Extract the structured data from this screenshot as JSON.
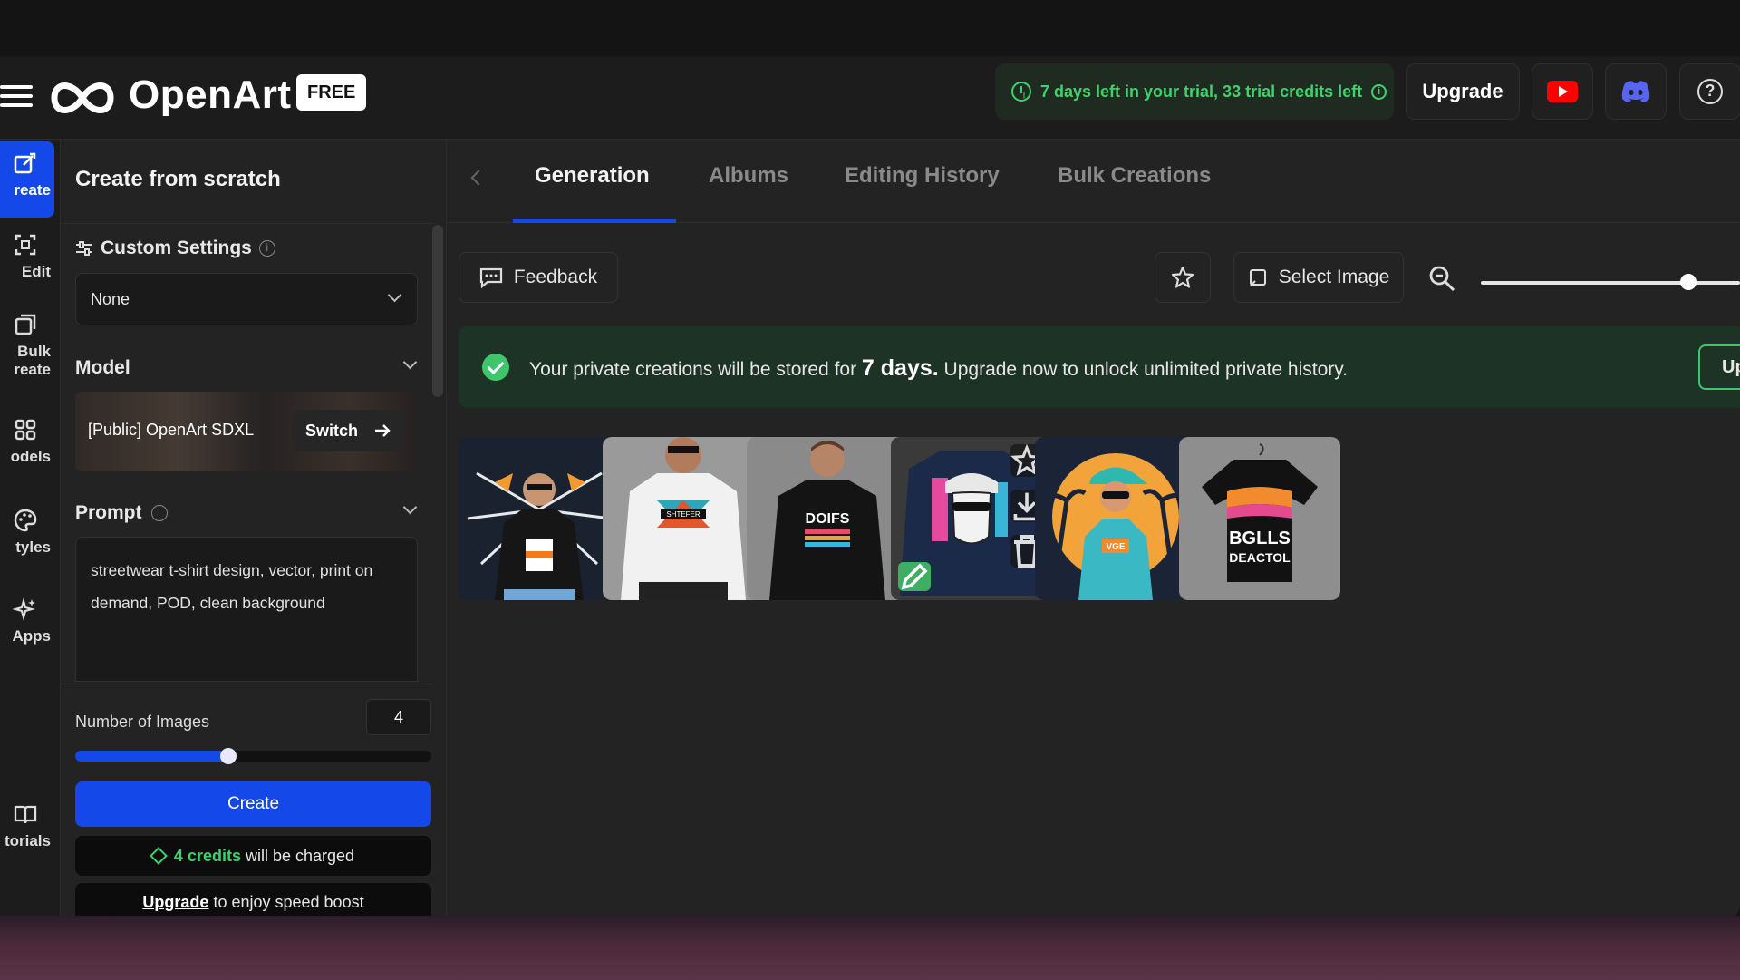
{
  "header": {
    "logo_text": "OpenArt",
    "plan_badge": "FREE",
    "trial_text": "7 days left in your trial, 33 trial credits left",
    "upgrade_label": "Upgrade",
    "icons": [
      "menu-icon",
      "openart-logo-icon",
      "clock-icon",
      "info-icon",
      "youtube-icon",
      "discord-icon",
      "help-icon"
    ]
  },
  "rail": {
    "items": [
      {
        "label": "reate",
        "icon": "create-icon",
        "active": true
      },
      {
        "label": "Edit",
        "icon": "edit-icon",
        "active": false
      },
      {
        "label1": "Bulk",
        "label2": "reate",
        "icon": "bulk-create-icon",
        "active": false
      },
      {
        "label": "odels",
        "icon": "models-icon",
        "active": false
      },
      {
        "label": "tyles",
        "icon": "styles-icon",
        "active": false
      },
      {
        "label": "Apps",
        "icon": "apps-icon",
        "active": false
      },
      {
        "label": "torials",
        "icon": "tutorials-icon",
        "active": false
      }
    ]
  },
  "panel": {
    "title": "Create from scratch",
    "custom_settings_label": "Custom Settings",
    "custom_settings_value": "None",
    "model_label": "Model",
    "model_name": "[Public] OpenArt SDXL",
    "switch_label": "Switch",
    "prompt_label": "Prompt",
    "prompt_text": "streetwear t-shirt design, vector, print on demand, POD, clean background",
    "num_images_label": "Number of Images",
    "num_images_value": "4",
    "num_images_fraction": 0.43,
    "create_label": "Create",
    "credits_amount": "4 credits",
    "credits_suffix": "will be charged",
    "boost_link": "Upgrade",
    "boost_suffix": "to enjoy speed boost"
  },
  "main": {
    "tabs": [
      {
        "label": "Generation",
        "active": true
      },
      {
        "label": "Albums",
        "active": false
      },
      {
        "label": "Editing History",
        "active": false
      },
      {
        "label": "Bulk Creations",
        "active": false
      }
    ],
    "feedback_label": "Feedback",
    "select_image_label": "Select Image",
    "zoom_fraction": 0.8,
    "banner_prefix": "Your private creations will be stored for",
    "banner_days": "7 days.",
    "banner_suffix": "Upgrade now to unlock unlimited private history.",
    "banner_button": "Upg",
    "thumb_texts": [
      "",
      "SHTEFER",
      "DOIFS",
      "",
      "VGE",
      "BGLLS DEACTOL"
    ]
  },
  "colors": {
    "accent_blue": "#1548e8",
    "success_green": "#3fd16b",
    "youtube_red": "#ff0000",
    "discord_blurple": "#5865f2"
  }
}
